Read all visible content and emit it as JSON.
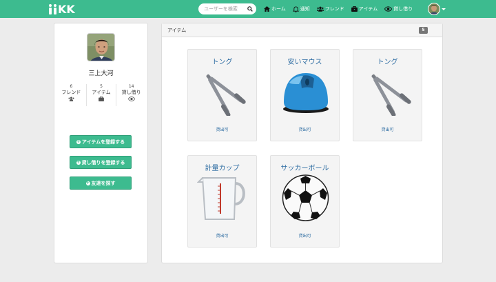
{
  "brand": {
    "name": "KK"
  },
  "search": {
    "placeholder": "ユーザーを検索"
  },
  "nav": {
    "items": [
      {
        "label": "ホーム",
        "icon": "home-icon"
      },
      {
        "label": "通知",
        "icon": "bell-icon"
      },
      {
        "label": "フレンド",
        "icon": "users-icon"
      },
      {
        "label": "アイテム",
        "icon": "briefcase-icon"
      },
      {
        "label": "貸し借り",
        "icon": "eye-icon"
      }
    ]
  },
  "profile": {
    "name": "三上大河",
    "stats": [
      {
        "count": "6",
        "label": "フレンド",
        "icon": "users-icon"
      },
      {
        "count": "5",
        "label": "アイテム",
        "icon": "briefcase-icon"
      },
      {
        "count": "14",
        "label": "貸し借り",
        "icon": "eye-icon"
      }
    ],
    "buttons": [
      {
        "label": "アイテムを登録する"
      },
      {
        "label": "貸し借りを登録する"
      },
      {
        "label": "友達を探す"
      }
    ]
  },
  "items_panel": {
    "title": "アイテム",
    "count": "5",
    "items": [
      {
        "name": "トング",
        "status": "貸出可",
        "image": "tongs"
      },
      {
        "name": "安いマウス",
        "status": "貸出可",
        "image": "mouse"
      },
      {
        "name": "トング",
        "status": "貸出可",
        "image": "tongs"
      },
      {
        "name": "計量カップ",
        "status": "貸出可",
        "image": "measuring-cup"
      },
      {
        "name": "サッカーボール",
        "status": "貸出可",
        "image": "soccer-ball"
      }
    ]
  },
  "colors": {
    "accent": "#3dbb8f",
    "link": "#2d6ca2"
  }
}
